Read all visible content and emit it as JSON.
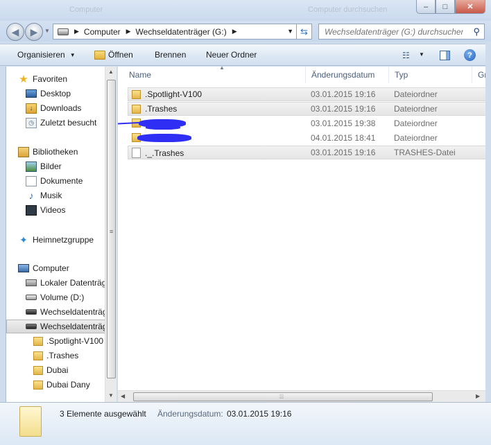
{
  "window": {
    "ghost_left": "Computer",
    "ghost_right": "Computer durchsuchen",
    "controls": {
      "minimize": "–",
      "maximize": "□",
      "close": "✕"
    }
  },
  "address": {
    "segments": [
      "Computer",
      "Wechseldatenträger (G:)"
    ],
    "search_placeholder": "Wechseldatenträger (G:) durchsuchen"
  },
  "toolbar": {
    "organize": "Organisieren",
    "open": "Öffnen",
    "burn": "Brennen",
    "new_folder": "Neuer Ordner"
  },
  "nav": {
    "favorites": "Favoriten",
    "desktop": "Desktop",
    "downloads": "Downloads",
    "recent": "Zuletzt besucht",
    "libraries": "Bibliotheken",
    "pictures": "Bilder",
    "documents": "Dokumente",
    "music": "Musik",
    "videos": "Videos",
    "homegroup": "Heimnetzgruppe",
    "computer": "Computer",
    "local_disk": "Lokaler Datenträger",
    "volume_d": "Volume (D:)",
    "removable_1": "Wechseldatenträger",
    "removable_2": "Wechseldatenträger",
    "sub_folders": [
      ".Spotlight-V100",
      ".Trashes",
      "Dubai",
      "Dubai Dany"
    ]
  },
  "columns": {
    "name": "Name",
    "date": "Änderungsdatum",
    "type": "Typ",
    "size": "Gr"
  },
  "files": [
    {
      "name": ".Spotlight-V100",
      "date": "03.01.2015 19:16",
      "type": "Dateiordner",
      "icon": "folder-icon"
    },
    {
      "name": ".Trashes",
      "date": "03.01.2015 19:16",
      "type": "Dateiordner",
      "icon": "folder-icon"
    },
    {
      "name": "",
      "date": "03.01.2015 19:38",
      "type": "Dateiordner",
      "icon": "folder-icon"
    },
    {
      "name": "",
      "date": "04.01.2015 18:41",
      "type": "Dateiordner",
      "icon": "folder-icon"
    },
    {
      "name": "._.Trashes",
      "date": "03.01.2015 19:16",
      "type": "TRASHES-Datei",
      "icon": "file-icon"
    }
  ],
  "details": {
    "count": "3 Elemente ausgewählt",
    "date_label": "Änderungsdatum:",
    "date_value": "03.01.2015 19:16"
  },
  "colors": {
    "selection_blue": "#cce4f7",
    "scribble": "#2e2ef5",
    "frame": "#cfdcec"
  }
}
